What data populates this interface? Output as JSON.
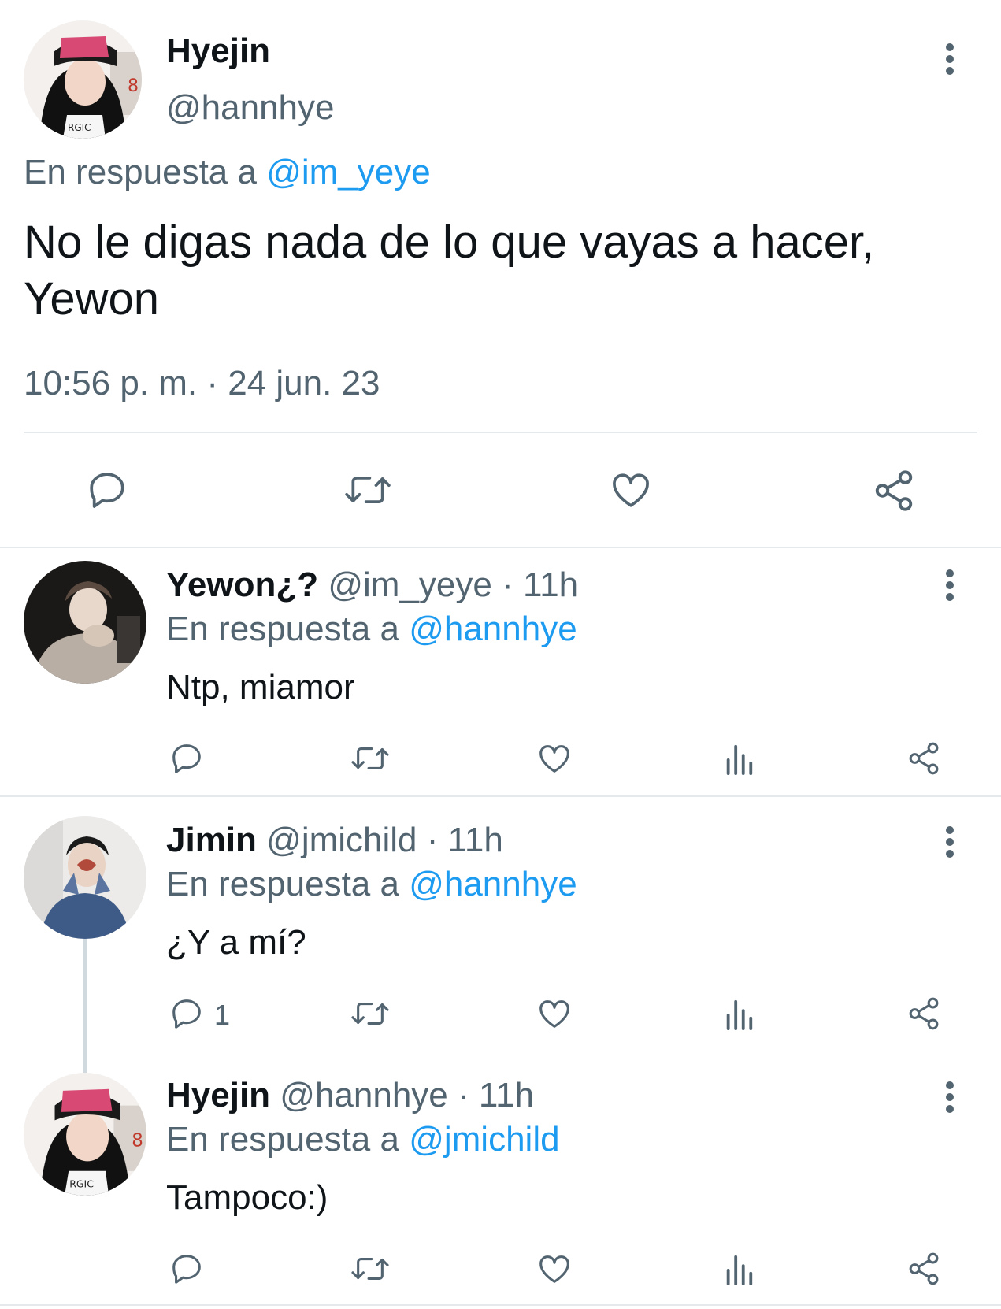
{
  "main_tweet": {
    "display_name": "Hyejin",
    "handle": "@hannhye",
    "reply_prefix": "En respuesta a",
    "reply_to": "@im_yeye",
    "text_line1": "No le digas nada de lo que vayas a hacer,",
    "text_line2": "Yewon",
    "timestamp": "10:56 p. m. · 24 jun. 23",
    "actions": [
      "reply-icon",
      "retweet-icon",
      "like-icon",
      "share-icon"
    ]
  },
  "replies": [
    {
      "display_name": "Yewon¿?",
      "handle": "@im_yeye",
      "time": "· 11h",
      "reply_prefix": "En respuesta a",
      "reply_to": "@hannhye",
      "text": "Ntp, miamor",
      "reply_count": ""
    },
    {
      "display_name": "Jimin",
      "handle": "@jmichild",
      "time": "· 11h",
      "reply_prefix": "En respuesta a",
      "reply_to": "@hannhye",
      "text": "¿Y a mí?",
      "reply_count": "1"
    },
    {
      "display_name": "Hyejin",
      "handle": "@hannhye",
      "time": "· 11h",
      "reply_prefix": "En respuesta a",
      "reply_to": "@jmichild",
      "text": "Tampoco:)",
      "reply_count": ""
    }
  ],
  "colors": {
    "text": "#0f1419",
    "muted": "#536471",
    "link": "#1d9bf0",
    "divider": "#e6e9ec"
  }
}
